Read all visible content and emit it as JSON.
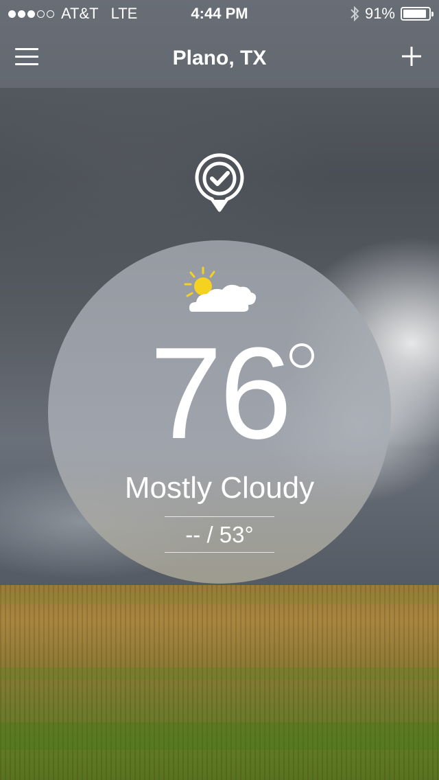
{
  "status_bar": {
    "carrier": "AT&T",
    "network": "LTE",
    "time": "4:44 PM",
    "battery": "91%",
    "battery_level": 0.91,
    "signal_bars_filled": 3,
    "signal_bars_total": 5
  },
  "nav": {
    "title": "Plano, TX",
    "menu_icon": "hamburger-menu-icon",
    "add_icon": "plus-icon"
  },
  "location_pin_icon": "location-check-icon",
  "weather": {
    "icon": "partly-cloudy-icon",
    "temperature": "76",
    "condition": "Mostly Cloudy",
    "hi_lo": "-- / 53°"
  },
  "colors": {
    "text": "#ffffff",
    "sun": "#f4d21f"
  }
}
